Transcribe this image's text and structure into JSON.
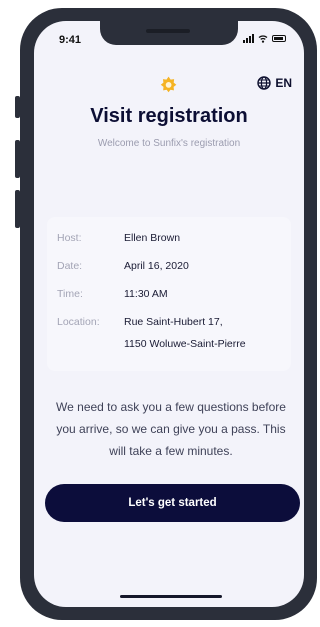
{
  "status": {
    "time": "9:41"
  },
  "header": {
    "language": "EN",
    "logo_icon": "flower-icon",
    "language_icon": "globe-icon"
  },
  "title": "Visit registration",
  "subtitle": "Welcome to Sunfix's registration",
  "details": {
    "host_label": "Host:",
    "host_value": "Ellen Brown",
    "date_label": "Date:",
    "date_value": "April 16, 2020",
    "time_label": "Time:",
    "time_value": "11:30 AM",
    "location_label": "Location:",
    "location_line1": "Rue Saint-Hubert 17,",
    "location_line2": "1150 Woluwe-Saint-Pierre"
  },
  "message": "We need to ask you a few questions before you arrive, so we can give you a pass. This will take a few minutes.",
  "cta_label": "Let's get started",
  "colors": {
    "accent": "#f5b323",
    "primary": "#0c0d3b",
    "background": "#f3f3fa"
  }
}
